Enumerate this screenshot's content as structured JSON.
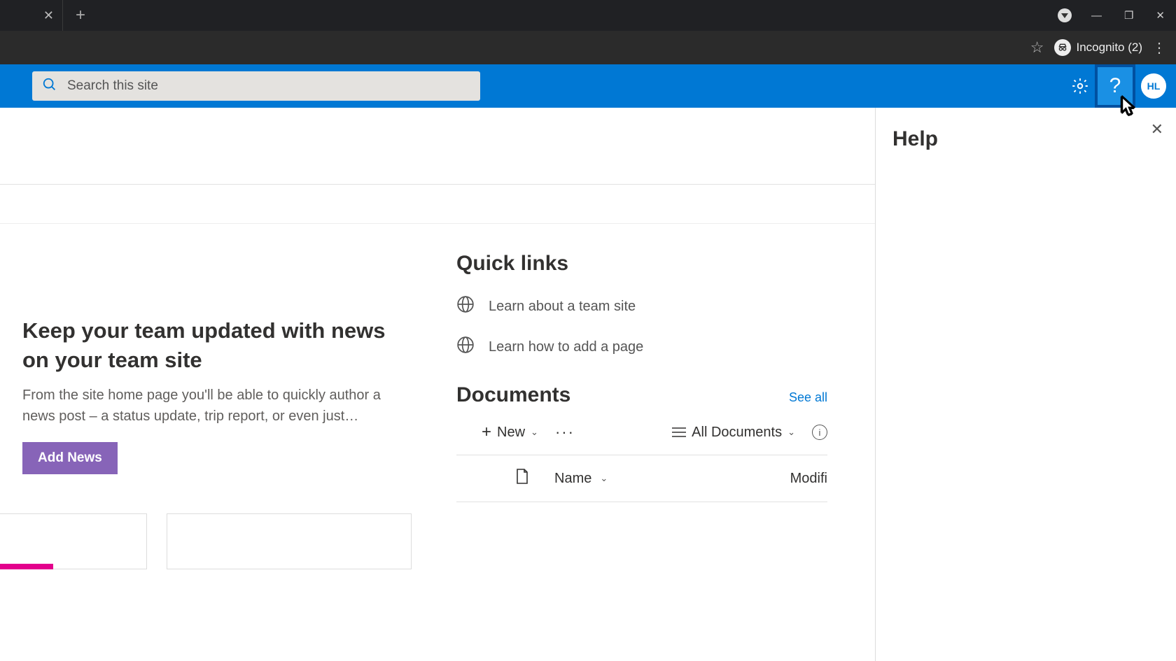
{
  "browser": {
    "incognito_label": "Incognito (2)"
  },
  "suite": {
    "search_placeholder": "Search this site",
    "avatar_initials": "HL"
  },
  "help_panel": {
    "title": "Help"
  },
  "news": {
    "heading": "Keep your team updated with news on your team site",
    "body": "From the site home page you'll be able to quickly author a news post – a status update, trip report, or even just…",
    "button": "Add News"
  },
  "quick_links": {
    "heading": "Quick links",
    "items": [
      {
        "label": "Learn about a team site"
      },
      {
        "label": "Learn how to add a page"
      }
    ]
  },
  "documents": {
    "heading": "Documents",
    "see_all": "See all",
    "new_label": "New",
    "view_label": "All Documents",
    "columns": {
      "name": "Name",
      "modified": "Modifi"
    }
  }
}
